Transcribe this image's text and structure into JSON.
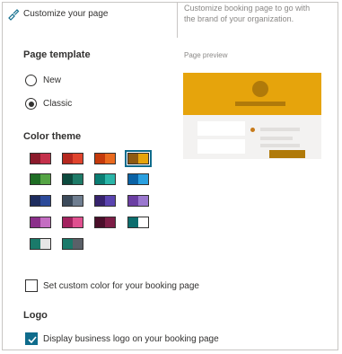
{
  "header": {
    "title": "Customize your page",
    "description": "Customize booking page to go with the brand of your organization."
  },
  "page_template": {
    "title": "Page template",
    "options": [
      {
        "label": "New",
        "selected": false
      },
      {
        "label": "Classic",
        "selected": true
      }
    ]
  },
  "color_theme": {
    "title": "Color theme",
    "swatches": [
      {
        "colors": [
          "#8b1a2b",
          "#c4314b"
        ],
        "selected": false
      },
      {
        "colors": [
          "#b5281f",
          "#e0442d"
        ],
        "selected": false
      },
      {
        "colors": [
          "#c53a0c",
          "#ea6a1f"
        ],
        "selected": false
      },
      {
        "colors": [
          "#8e5a12",
          "#e6a40c"
        ],
        "selected": true
      },
      {
        "colors": [
          "#1e6d24",
          "#55a444"
        ],
        "selected": false
      },
      {
        "colors": [
          "#0c4a3e",
          "#1e7b68"
        ],
        "selected": false
      },
      {
        "colors": [
          "#0a7d73",
          "#2ab5a8"
        ],
        "selected": false
      },
      {
        "colors": [
          "#0a62a5",
          "#2aa0e0"
        ],
        "selected": false
      },
      {
        "colors": [
          "#1d2c5e",
          "#2c4a9a"
        ],
        "selected": false
      },
      {
        "colors": [
          "#3c4a5a",
          "#6f7e90"
        ],
        "selected": false
      },
      {
        "colors": [
          "#37236e",
          "#5a44b0"
        ],
        "selected": false
      },
      {
        "colors": [
          "#6b3fa3",
          "#9b78cf"
        ],
        "selected": false
      },
      {
        "colors": [
          "#8b2f8a",
          "#c46dc2"
        ],
        "selected": false
      },
      {
        "colors": [
          "#a3235f",
          "#e0508f"
        ],
        "selected": false
      },
      {
        "colors": [
          "#4a0f2a",
          "#7d1d46"
        ],
        "selected": false
      },
      {
        "colors": [
          "#0d6e6e",
          "#ffffff"
        ],
        "selected": false
      },
      {
        "colors": [
          "#1a7a6a",
          "#e6e6e6"
        ],
        "selected": false
      },
      {
        "colors": [
          "#1a7a6a",
          "#5a6068"
        ],
        "selected": false
      }
    ]
  },
  "preview": {
    "label": "Page preview"
  },
  "custom_color": {
    "label": "Set custom color for your booking page",
    "checked": false
  },
  "logo": {
    "title": "Logo",
    "display_label": "Display business logo on your booking page",
    "checked": true
  },
  "colors": {
    "accent": "#0f6c8c",
    "border": "#c8c6c4",
    "preview_banner": "#e6a40c"
  }
}
